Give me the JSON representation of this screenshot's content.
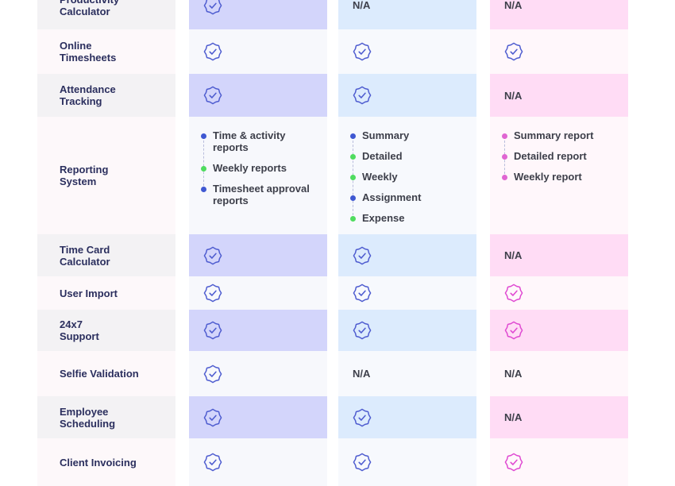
{
  "colors": {
    "feature_odd": "#f3f2f4",
    "feature_even": "#fdf8fa",
    "col1_dark": "#d3d5fb",
    "col1_light": "#f7f8fc",
    "col2_dark": "#dcebfd",
    "col2_light": "#f7f9fd",
    "col3_dark": "#ffdcf5",
    "col3_light": "#fff7fb",
    "check_blue": "#4f5dd0",
    "check_pink": "#e04ad2",
    "dot_blue": "#3f58d2",
    "dot_green": "#4fdc5f",
    "dot_pink": "#e066d2"
  },
  "rows": [
    {
      "feature": "Productivity\nCalculator",
      "c1": "check",
      "c2": "N/A",
      "c3": "N/A"
    },
    {
      "feature": "Online\nTimesheets",
      "c1": "check",
      "c2": "check",
      "c3": "check"
    },
    {
      "feature": "Attendance\nTracking",
      "c1": "check",
      "c2": "check",
      "c3": "N/A"
    },
    {
      "feature": "Reporting\nSystem",
      "c1_list": [
        {
          "text": "Time & activity\nreports",
          "dot": "blue"
        },
        {
          "text": "Weekly reports",
          "dot": "green"
        },
        {
          "text": "Timesheet approval\nreports",
          "dot": "blue"
        }
      ],
      "c2_list": [
        {
          "text": "Summary",
          "dot": "blue"
        },
        {
          "text": "Detailed",
          "dot": "green"
        },
        {
          "text": "Weekly",
          "dot": "green"
        },
        {
          "text": "Assignment",
          "dot": "blue"
        },
        {
          "text": "Expense",
          "dot": "green"
        }
      ],
      "c3_list": [
        {
          "text": "Summary report",
          "dot": "pink"
        },
        {
          "text": "Detailed report",
          "dot": "pink"
        },
        {
          "text": "Weekly report",
          "dot": "pink"
        }
      ]
    },
    {
      "feature": "Time Card\nCalculator",
      "c1": "check",
      "c2": "check",
      "c3": "N/A"
    },
    {
      "feature": "User Import",
      "c1": "check",
      "c2": "check",
      "c3": "check-pink"
    },
    {
      "feature": "24x7\nSupport",
      "c1": "check",
      "c2": "check",
      "c3": "check-pink"
    },
    {
      "feature": "Selfie Validation",
      "c1": "check",
      "c2": "N/A",
      "c3": "N/A"
    },
    {
      "feature": "Employee\nScheduling",
      "c1": "check",
      "c2": "check",
      "c3": "N/A"
    },
    {
      "feature": "Client Invoicing",
      "c1": "check",
      "c2": "check",
      "c3": "check-pink"
    }
  ]
}
